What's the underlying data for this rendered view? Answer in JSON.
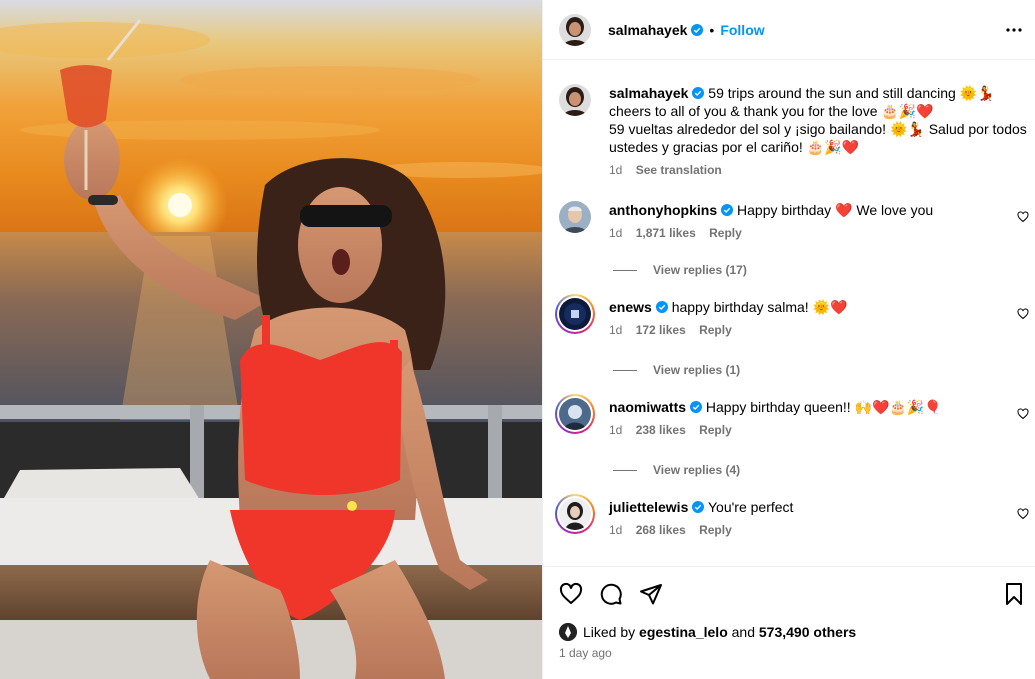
{
  "post": {
    "author": "salmahayek",
    "follow_label": "Follow",
    "dot": "•",
    "caption_lines": [
      "59 trips around the sun and still dancing 🌞💃",
      "cheers to all of you & thank you for the love 🎂🎉❤️",
      "59 vueltas alrededor del sol y ¡sigo bailando! 🌞💃 Salud por todos",
      "ustedes y gracias por el cariño! 🎂🎉❤️"
    ],
    "caption_time": "1d",
    "see_translation": "See translation"
  },
  "comments": [
    {
      "user": "anthonyhopkins",
      "text": "Happy birthday ❤️ We love you",
      "time": "1d",
      "likes": "1,871 likes",
      "reply": "Reply",
      "view_replies": "View replies (17)"
    },
    {
      "user": "enews",
      "text": "happy birthday salma! 🌞❤️",
      "time": "1d",
      "likes": "172 likes",
      "reply": "Reply",
      "view_replies": "View replies (1)"
    },
    {
      "user": "naomiwatts",
      "text": "Happy birthday queen!! 🙌❤️🎂🎉🎈",
      "time": "1d",
      "likes": "238 likes",
      "reply": "Reply",
      "view_replies": "View replies (4)"
    },
    {
      "user": "juliettelewis",
      "text": "You're perfect",
      "time": "1d",
      "likes": "268 likes",
      "reply": "Reply"
    }
  ],
  "footer": {
    "liked_prefix": "Liked by",
    "liked_user": "egestina_lelo",
    "liked_mid": "and",
    "liked_count": "573,490 others",
    "posted_ago": "1 day ago"
  },
  "icons": {
    "verified": "verified-badge-icon",
    "more": "more-options-icon",
    "like": "heart-icon",
    "comment": "comment-icon",
    "share": "share-icon",
    "save": "bookmark-icon"
  },
  "colors": {
    "accent": "#0095f6",
    "muted": "#737373",
    "divider": "#efefef"
  }
}
